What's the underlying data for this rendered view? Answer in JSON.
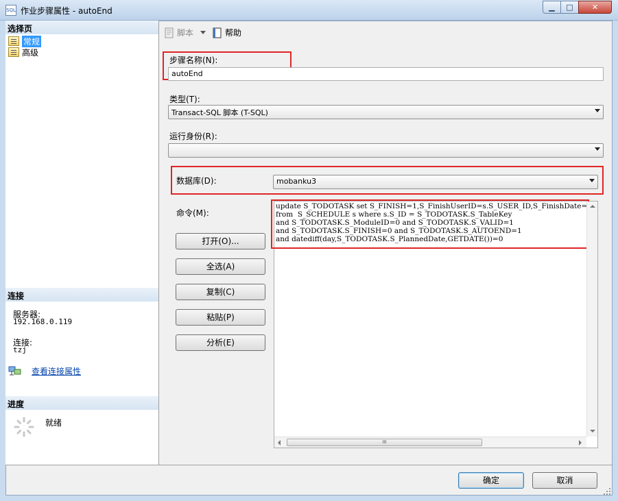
{
  "window": {
    "title": "作业步骤属性 - autoEnd",
    "icon": "app-window-icon",
    "minimize_glyph": "▁",
    "maximize_glyph": "□",
    "close_glyph": "✕"
  },
  "left": {
    "pages_header": "选择页",
    "pages": [
      {
        "label": "常规",
        "selected": true,
        "icon": "page-icon"
      },
      {
        "label": "高级",
        "selected": false,
        "icon": "page-icon"
      }
    ],
    "connection_header": "连接",
    "server_label": "服务器:",
    "server_value": "192.168.0.119",
    "connection_label": "连接:",
    "connection_value": "tzj",
    "view_connection_link": "查看连接属性",
    "progress_header": "进度",
    "progress_status": "就绪"
  },
  "toolbar": {
    "script_label": "脚本",
    "help_label": "帮助"
  },
  "form": {
    "step_name_label": "步骤名称(N):",
    "step_name_value": "autoEnd",
    "type_label": "类型(T):",
    "type_value": "Transact-SQL 脚本 (T-SQL)",
    "run_as_label": "运行身份(R):",
    "run_as_value": "",
    "database_label": "数据库(D):",
    "database_value": "mobanku3",
    "command_label": "命令(M):",
    "command_text": "update S_TODOTASK set S_FINISH=1,S_FinishUserID=s.S_USER_ID,S_FinishDate=GE\nfrom  S_SCHEDULE s where s.S_ID = S_TODOTASK.S_TableKey\nand S_TODOTASK.S_ModuleID=0 and S_TODOTASK.S_VALID=1\nand S_TODOTASK.S_FINISH=0 and S_TODOTASK.S_AUTOEND=1\nand datediff(day,S_TODOTASK.S_PlannedDate,GETDATE())=0"
  },
  "buttons": {
    "open": "打开(O)...",
    "select_all": "全选(A)",
    "copy": "复制(C)",
    "paste": "粘贴(P)",
    "parse": "分析(E)",
    "ok": "确定",
    "cancel": "取消"
  },
  "scroll": {
    "hthumb_glyph": "III"
  },
  "colors": {
    "highlight_red": "#e02424",
    "selection_blue": "#3399ff",
    "link_blue": "#0645ad"
  }
}
